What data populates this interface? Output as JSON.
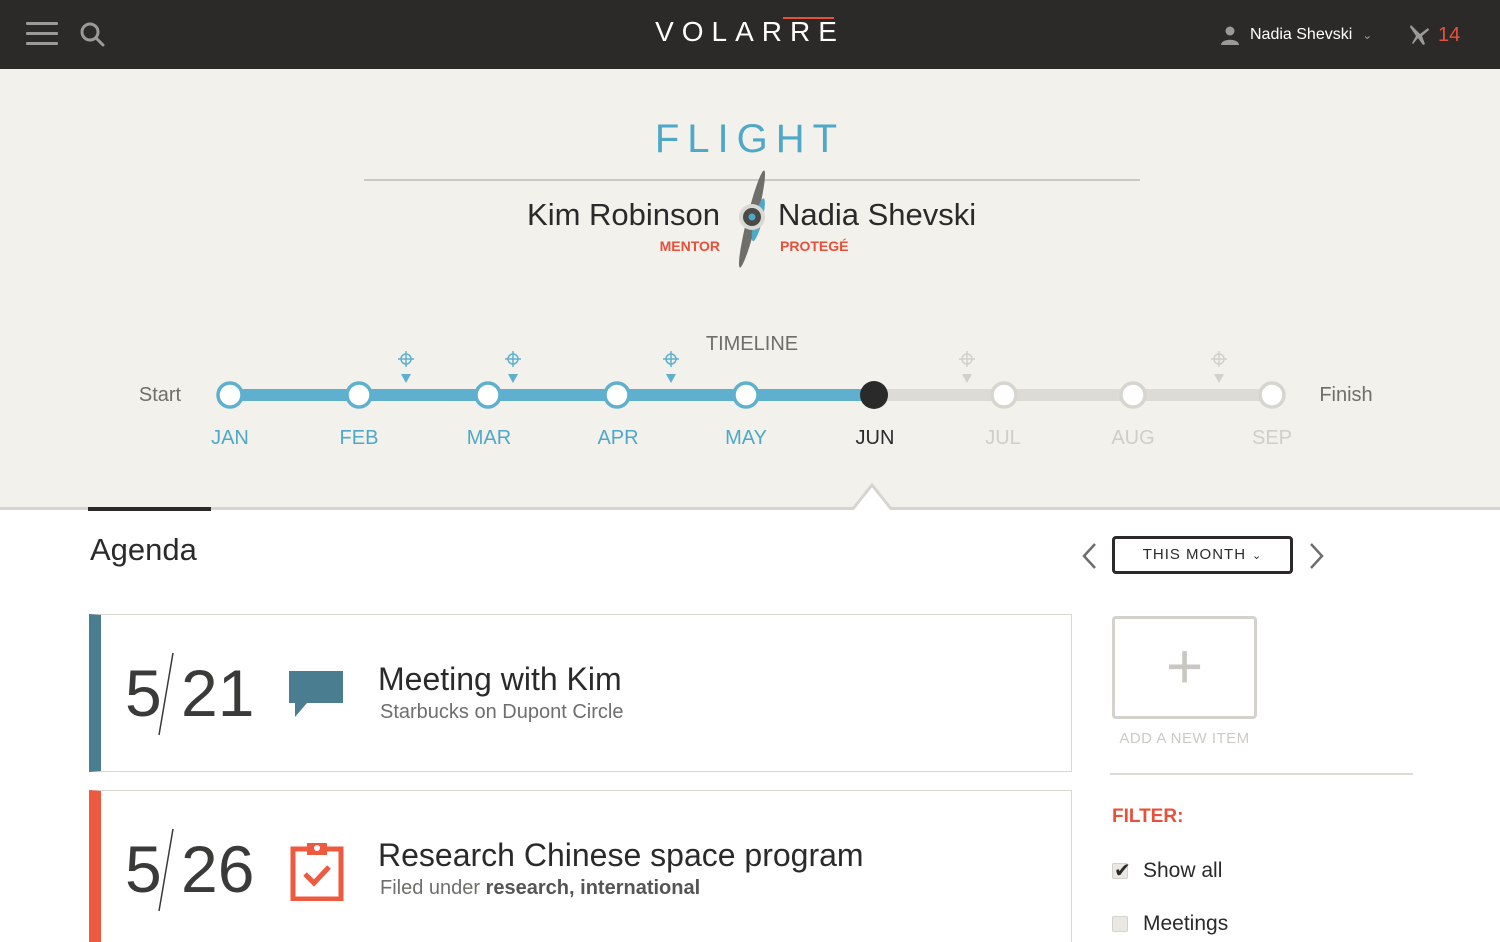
{
  "app": {
    "logo": "VOLARRE",
    "user_name": "Nadia Shevski",
    "notification_count": "14"
  },
  "flight": {
    "title": "FLIGHT",
    "mentor": {
      "name": "Kim Robinson",
      "role": "MENTOR"
    },
    "protege": {
      "name": "Nadia Shevski",
      "role": "PROTEGÉ"
    }
  },
  "timeline": {
    "label": "TIMELINE",
    "start": "Start",
    "finish": "Finish",
    "months": [
      "JAN",
      "FEB",
      "MAR",
      "APR",
      "MAY",
      "JUN",
      "JUL",
      "AUG",
      "SEP"
    ],
    "current_index": 5
  },
  "agenda": {
    "title": "Agenda",
    "period": "THIS MONTH",
    "items": [
      {
        "month": "5",
        "day": "21",
        "type": "meeting-icon",
        "title": "Meeting with Kim",
        "subtitle": "Starbucks on Dupont Circle",
        "color": "#4a7d90"
      },
      {
        "month": "5",
        "day": "26",
        "type": "task-icon",
        "title": "Research Chinese space program",
        "subtitle_prefix": "Filed under ",
        "tags": "research, international",
        "color": "#ee5a40"
      }
    ]
  },
  "sidebar": {
    "add_label": "ADD A NEW ITEM",
    "filter_label": "FILTER:",
    "filters": [
      {
        "label": "Show all",
        "checked": true
      },
      {
        "label": "Meetings",
        "checked": false
      }
    ]
  },
  "colors": {
    "accent": "#e8503a",
    "timeline_done": "#4fa8c8",
    "timeline_future": "#cfcec8",
    "topbar": "#2b2a28"
  }
}
